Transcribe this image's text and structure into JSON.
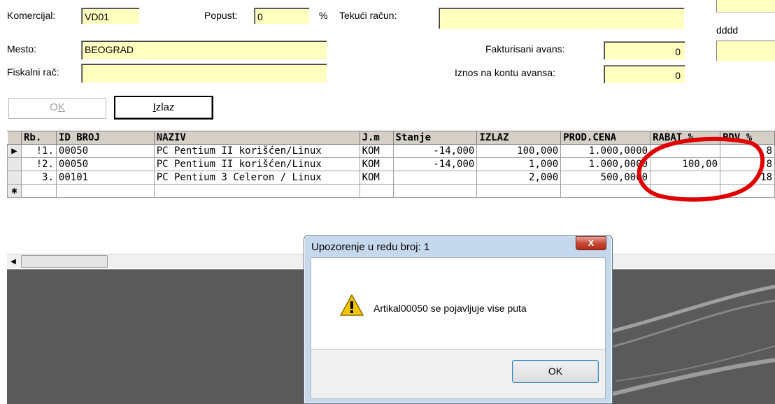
{
  "form": {
    "komercijal_label": "Komercijal:",
    "komercijal_value": "VD01",
    "popust_label": "Popust:",
    "popust_value": "0",
    "percent_sign": "%",
    "tekuci_label": "Tekući račun:",
    "tekuci_value": "",
    "dddd_label": "dddd",
    "mesto_label": "Mesto:",
    "mesto_value": "BEOGRAD",
    "fakturisani_label": "Fakturisani avans:",
    "fakturisani_value": "0",
    "fiskalni_label": "Fiskalni rač:",
    "fiskalni_value": "",
    "iznos_label": "Iznos na kontu avansa:",
    "iznos_value": "0"
  },
  "buttons": {
    "ok_main": "O",
    "ok_underline": "K",
    "izlaz_main": "zlaz",
    "izlaz_underline": "I"
  },
  "grid": {
    "columns": [
      "Rb.",
      "ID BROJ",
      "NAZIV",
      "J.m",
      "Stanje",
      "IZLAZ",
      "PROD.CENA",
      "RABAT %",
      "PDV %"
    ],
    "rows": [
      {
        "marker": "▶",
        "rb": "!1.",
        "id": "00050",
        "naziv": "PC Pentium II korišćen/Linux",
        "jm": "KOM",
        "stanje": "-14,000",
        "izlaz": "100,000",
        "cena": "1.000,0000",
        "rabat": "",
        "pdv": "8"
      },
      {
        "marker": "",
        "rb": "!2.",
        "id": "00050",
        "naziv": "PC Pentium II korišćen/Linux",
        "jm": "KOM",
        "stanje": "-14,000",
        "izlaz": "1,000",
        "cena": "1.000,0000",
        "rabat": "100,00",
        "pdv": "8"
      },
      {
        "marker": "",
        "rb": "3.",
        "id": "00101",
        "naziv": "PC Pentium 3 Celeron / Linux",
        "jm": "KOM",
        "stanje": "",
        "izlaz": "2,000",
        "cena": "500,0000",
        "rabat": "",
        "pdv": "18"
      },
      {
        "marker": "✱",
        "rb": "",
        "id": "",
        "naziv": "",
        "jm": "",
        "stanje": "",
        "izlaz": "",
        "cena": "",
        "rabat": "",
        "pdv": ""
      }
    ]
  },
  "dialog": {
    "title": "Upozorenje u redu broj: 1",
    "close_label": "X",
    "message": "Artikal00050 se pojavljuje vise puta",
    "ok_label": "OK"
  },
  "colors": {
    "field_bg": "#ffffc0",
    "annotation_red": "#e00000"
  }
}
